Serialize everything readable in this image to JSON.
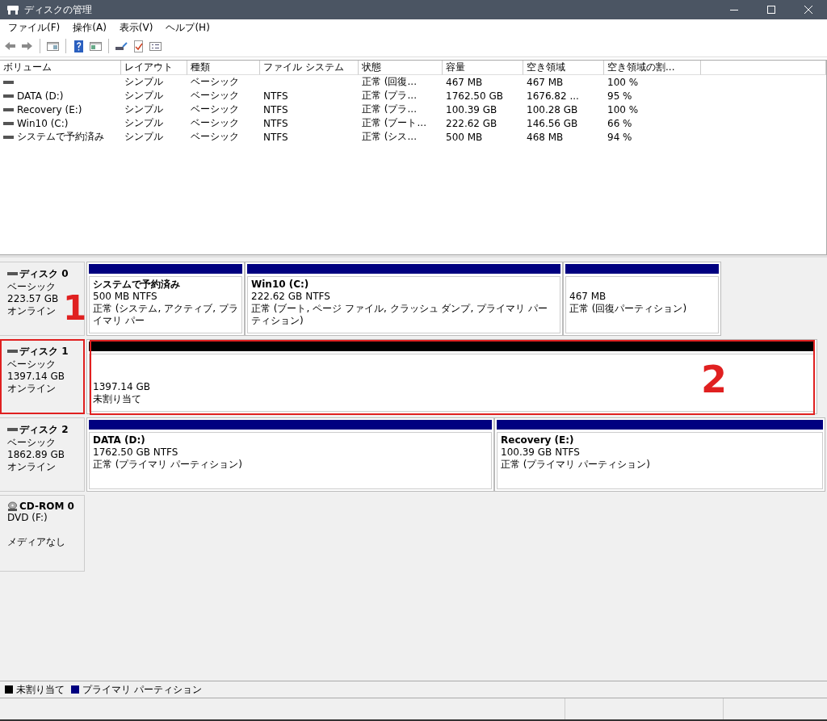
{
  "window": {
    "title": "ディスクの管理"
  },
  "menu": [
    {
      "label": "ファイル(F)"
    },
    {
      "label": "操作(A)"
    },
    {
      "label": "表示(V)"
    },
    {
      "label": "ヘルプ(H)"
    }
  ],
  "volume_table": {
    "columns": [
      "ボリューム",
      "レイアウト",
      "種類",
      "ファイル システム",
      "状態",
      "容量",
      "空き領域",
      "空き領域の割..."
    ],
    "rows": [
      [
        "",
        "シンプル",
        "ベーシック",
        "",
        "正常 (回復...",
        "467 MB",
        "467 MB",
        "100 %"
      ],
      [
        "DATA (D:)",
        "シンプル",
        "ベーシック",
        "NTFS",
        "正常 (プラ...",
        "1762.50 GB",
        "1676.82 ...",
        "95 %"
      ],
      [
        "Recovery (E:)",
        "シンプル",
        "ベーシック",
        "NTFS",
        "正常 (プラ...",
        "100.39 GB",
        "100.28 GB",
        "100 %"
      ],
      [
        "Win10 (C:)",
        "シンプル",
        "ベーシック",
        "NTFS",
        "正常 (ブート...",
        "222.62 GB",
        "146.56 GB",
        "66 %"
      ],
      [
        "システムで予約済み",
        "シンプル",
        "ベーシック",
        "NTFS",
        "正常 (シス...",
        "500 MB",
        "468 MB",
        "94 %"
      ]
    ]
  },
  "disks": [
    {
      "kind": "disk",
      "name": "ディスク 0",
      "lines": [
        "ベーシック",
        "223.57 GB",
        "オンライン"
      ],
      "annotation": "1",
      "highlighted": false,
      "partitions": [
        {
          "kind": "primary",
          "title": "システムで予約済み",
          "size": "500 MB NTFS",
          "status": "正常 (システム, アクティブ, プライマリ パー"
        },
        {
          "kind": "primary",
          "title": "Win10  (C:)",
          "size": "222.62 GB NTFS",
          "status": "正常 (ブート, ページ ファイル, クラッシュ ダンプ, プライマリ パーティション)"
        },
        {
          "kind": "primary",
          "size": "467 MB",
          "status": "正常 (回復パーティション)"
        }
      ]
    },
    {
      "kind": "disk",
      "name": "ディスク 1",
      "lines": [
        "ベーシック",
        "1397.14 GB",
        "オンライン"
      ],
      "highlighted": true,
      "partitions": [
        {
          "kind": "unallocated",
          "size": "1397.14 GB",
          "status": "未割り当て",
          "annotation": "2",
          "highlighted": true
        }
      ]
    },
    {
      "kind": "disk",
      "name": "ディスク 2",
      "lines": [
        "ベーシック",
        "1862.89 GB",
        "オンライン"
      ],
      "highlighted": false,
      "partitions": [
        {
          "kind": "primary",
          "title": "DATA  (D:)",
          "size": "1762.50 GB NTFS",
          "status": "正常 (プライマリ パーティション)"
        },
        {
          "kind": "primary",
          "title": "Recovery  (E:)",
          "size": "100.39 GB NTFS",
          "status": "正常 (プライマリ パーティション)"
        }
      ]
    },
    {
      "kind": "cdrom",
      "name": "CD-ROM 0",
      "lines": [
        "DVD (F:)",
        "メディアなし"
      ],
      "highlighted": false
    }
  ],
  "legend": [
    {
      "label": "未割り当て",
      "color": "#000000"
    },
    {
      "label": "プライマリ パーティション",
      "color": "#000080"
    }
  ]
}
